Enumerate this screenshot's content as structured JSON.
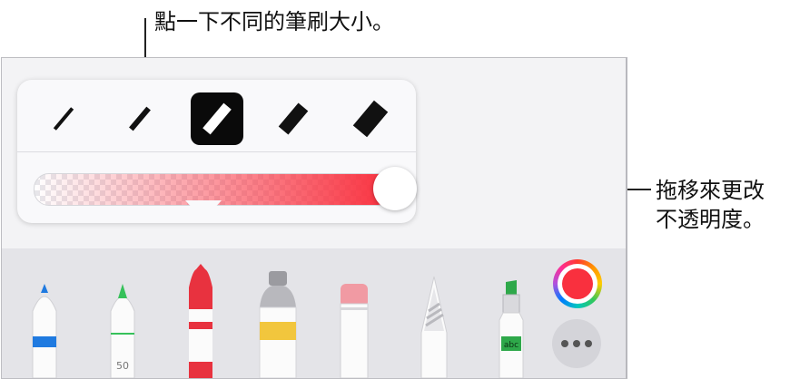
{
  "annotations": {
    "top": "點一下不同的筆刷大小。",
    "right_line1": "拖移來更改",
    "right_line2": "不透明度。"
  },
  "brush_sizes": {
    "selected_index": 3,
    "options": [
      "size-1",
      "size-2",
      "size-3",
      "size-4",
      "size-5"
    ]
  },
  "opacity": {
    "value": 1.0,
    "color": "#f9303e"
  },
  "tools": [
    {
      "name": "pen",
      "color": "#1f7ae0"
    },
    {
      "name": "monoline",
      "color": "#36c15a",
      "label": "50"
    },
    {
      "name": "crayon",
      "color": "#e8323f"
    },
    {
      "name": "paint",
      "color": "#f2c63d"
    },
    {
      "name": "eraser",
      "color": "#f19aa3"
    },
    {
      "name": "pencil",
      "color": "#bdbdc2"
    },
    {
      "name": "marker",
      "color": "#2ea84a",
      "label": "abc"
    }
  ],
  "color_picker": {
    "current_color": "#f9303e"
  },
  "more_button": {
    "icon": "ellipsis-icon"
  }
}
